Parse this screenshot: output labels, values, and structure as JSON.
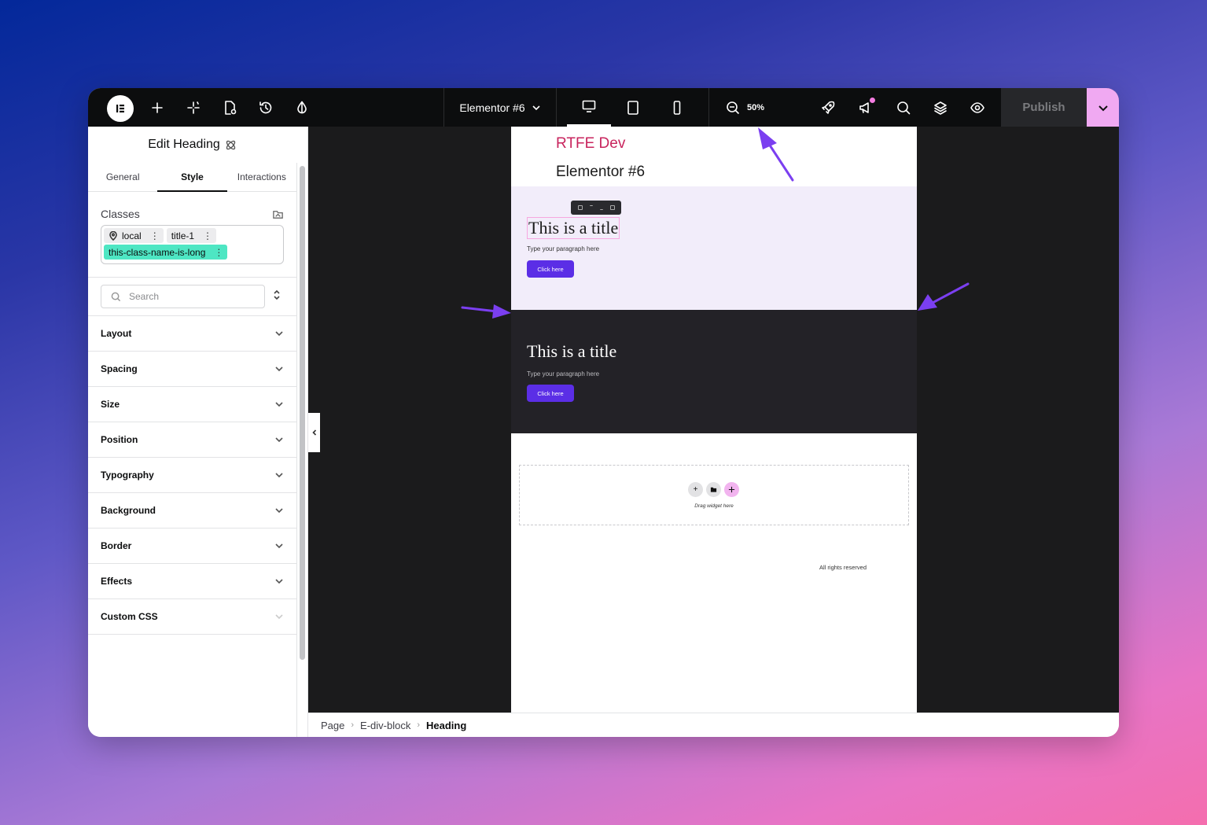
{
  "topbar": {
    "document_title": "Elementor #6",
    "zoom_level": "50%",
    "publish_label": "Publish"
  },
  "panel": {
    "title": "Edit Heading",
    "tabs": [
      {
        "label": "General",
        "active": false
      },
      {
        "label": "Style",
        "active": true
      },
      {
        "label": "Interactions",
        "active": false
      }
    ],
    "classes": {
      "label": "Classes",
      "chips": [
        "local",
        "title-1",
        "this-class-name-is-long"
      ]
    },
    "search": {
      "placeholder": "Search"
    },
    "sections": [
      "Layout",
      "Spacing",
      "Size",
      "Position",
      "Typography",
      "Background",
      "Border",
      "Effects",
      "Custom CSS"
    ]
  },
  "canvas": {
    "site_name": "RTFE Dev",
    "page_name": "Elementor #6",
    "blocks": [
      {
        "title": "This is a title",
        "paragraph": "Type your paragraph here",
        "button": "Click here"
      },
      {
        "title": "This is a title",
        "paragraph": "Type your paragraph here",
        "button": "Click here"
      }
    ],
    "drop_zone_text": "Drag widget here",
    "footer_text": "All rights reserved"
  },
  "breadcrumb": [
    "Page",
    "E-div-block",
    "Heading"
  ],
  "colors": {
    "accent_purple": "#5b2ee6",
    "site_name_red": "#c8245d",
    "class_chip_green": "#4ee6c3",
    "publish_more_pink": "#f0a9f2",
    "annotation_arrow": "#7b3ff0"
  }
}
